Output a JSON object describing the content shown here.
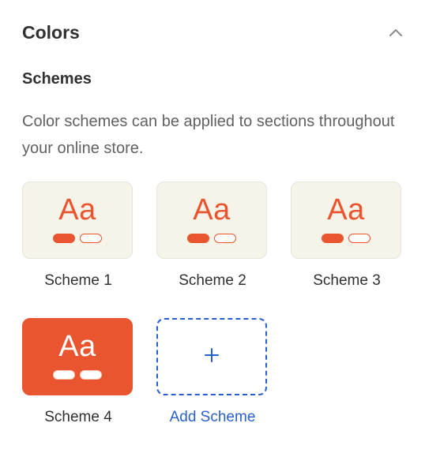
{
  "section": {
    "title": "Colors",
    "collapse_icon": "chevron-up-icon"
  },
  "schemes": {
    "heading": "Schemes",
    "description": "Color schemes can be applied to sections throughout your online store.",
    "items": [
      {
        "label": "Scheme 1",
        "sample_text": "Aa",
        "background": "#f6f3e8",
        "accent": "#e8552f"
      },
      {
        "label": "Scheme 2",
        "sample_text": "Aa",
        "background": "#f6f3e8",
        "accent": "#e8552f"
      },
      {
        "label": "Scheme 3",
        "sample_text": "Aa",
        "background": "#f6f3e8",
        "accent": "#e8552f"
      },
      {
        "label": "Scheme 4",
        "sample_text": "Aa",
        "background": "#e8552f",
        "accent": "#ffffff"
      }
    ],
    "add": {
      "label": "Add Scheme",
      "icon": "plus-icon",
      "symbol": "+"
    }
  },
  "colors": {
    "link": "#2a61c8",
    "accent": "#e8552f"
  }
}
